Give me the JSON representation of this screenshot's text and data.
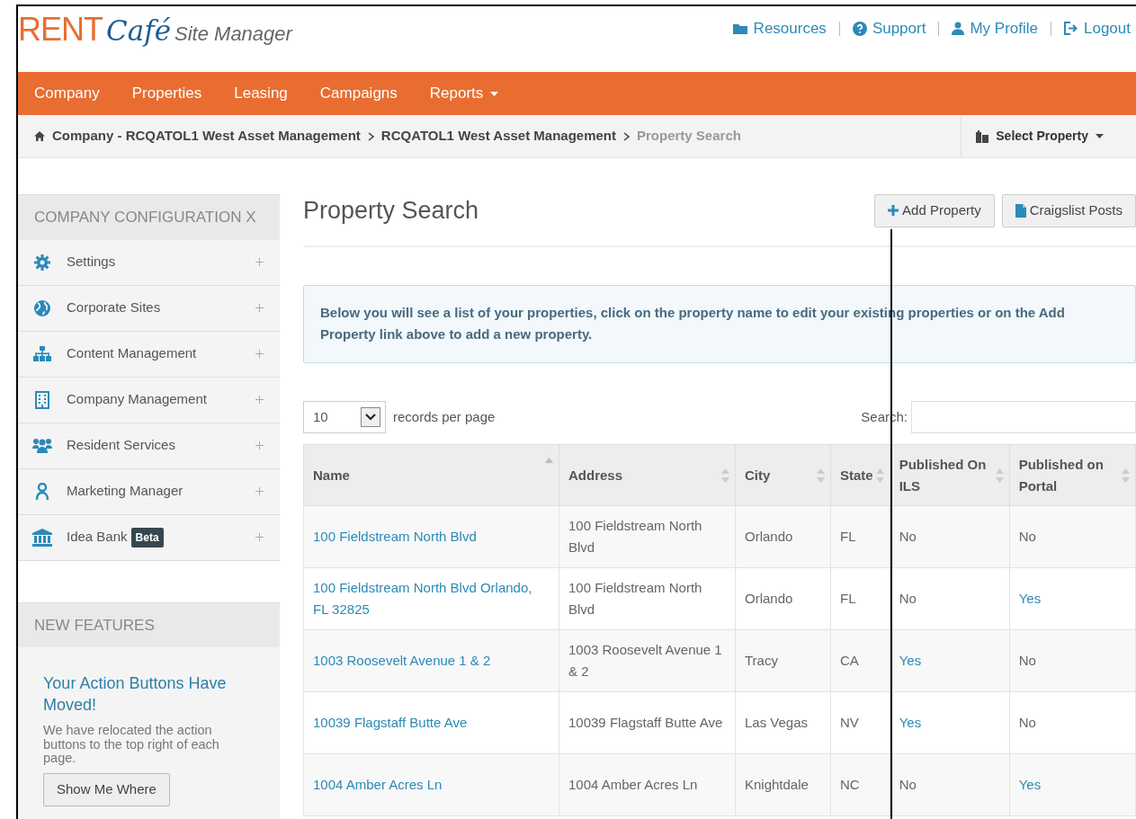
{
  "logo": {
    "brand": "RENT",
    "script": "Café",
    "product": "Site Manager"
  },
  "top_links": [
    {
      "label": "Resources"
    },
    {
      "label": "Support"
    },
    {
      "label": "My Profile"
    },
    {
      "label": "Logout"
    }
  ],
  "nav": [
    {
      "label": "Company",
      "dropdown": false
    },
    {
      "label": "Properties",
      "dropdown": false
    },
    {
      "label": "Leasing",
      "dropdown": false
    },
    {
      "label": "Campaigns",
      "dropdown": false
    },
    {
      "label": "Reports",
      "dropdown": true
    }
  ],
  "breadcrumb": [
    {
      "label": "Company - RCQATOL1 West Asset Management",
      "current": false
    },
    {
      "label": "RCQATOL1 West Asset Management",
      "current": false
    },
    {
      "label": "Property Search",
      "current": true
    }
  ],
  "property_selector": {
    "label": "Select Property"
  },
  "sidebar": {
    "title": "COMPANY CONFIGURATION X",
    "items": [
      {
        "label": "Settings"
      },
      {
        "label": "Corporate Sites"
      },
      {
        "label": "Content Management"
      },
      {
        "label": "Company Management"
      },
      {
        "label": "Resident Services"
      },
      {
        "label": "Marketing Manager"
      },
      {
        "label": "Idea Bank",
        "badge": "Beta"
      }
    ]
  },
  "new_features": {
    "title": "NEW FEATURES",
    "heading": "Your Action Buttons Have Moved!",
    "text": "We have relocated the action buttons to the top right of each page.",
    "button": "Show Me Where"
  },
  "page_title": "Property Search",
  "actions": [
    {
      "label": "Add Property"
    },
    {
      "label": "Craigslist Posts"
    }
  ],
  "info": "Below you will see a list of your properties, click on the property name to edit your existing properties or on the Add Property link above to add a new property.",
  "page_size": {
    "value": "10",
    "label": "records per page"
  },
  "search": {
    "label": "Search:"
  },
  "table": {
    "columns": [
      {
        "label": "Name",
        "sorted": true
      },
      {
        "label": "Address",
        "sorted": false
      },
      {
        "label": "City",
        "sorted": false
      },
      {
        "label": "State",
        "sorted": false
      },
      {
        "label": "Published On ILS",
        "sorted": false
      },
      {
        "label": "Published on Portal",
        "sorted": false
      }
    ],
    "rows": [
      {
        "name": "100 Fieldstream North Blvd",
        "address": "100 Fieldstream North Blvd",
        "city": "Orlando",
        "state": "FL",
        "ils": {
          "text": "No",
          "link": false
        },
        "portal": {
          "text": "No",
          "link": false
        }
      },
      {
        "name": "100 Fieldstream North Blvd Orlando, FL 32825",
        "address": "100 Fieldstream North Blvd",
        "city": "Orlando",
        "state": "FL",
        "ils": {
          "text": "No",
          "link": false
        },
        "portal": {
          "text": "Yes",
          "link": true
        }
      },
      {
        "name": "1003 Roosevelt Avenue 1 & 2",
        "address": "1003 Roosevelt Avenue 1 & 2",
        "city": "Tracy",
        "state": "CA",
        "ils": {
          "text": "Yes",
          "link": true
        },
        "portal": {
          "text": "No",
          "link": false
        }
      },
      {
        "name": "10039 Flagstaff Butte Ave",
        "address": "10039 Flagstaff Butte Ave",
        "city": "Las Vegas",
        "state": "NV",
        "ils": {
          "text": "Yes",
          "link": true
        },
        "portal": {
          "text": "No",
          "link": false
        }
      },
      {
        "name": "1004 Amber Acres Ln",
        "address": "1004 Amber Acres Ln",
        "city": "Knightdale",
        "state": "NC",
        "ils": {
          "text": "No",
          "link": false
        },
        "portal": {
          "text": "Yes",
          "link": true
        }
      }
    ]
  }
}
